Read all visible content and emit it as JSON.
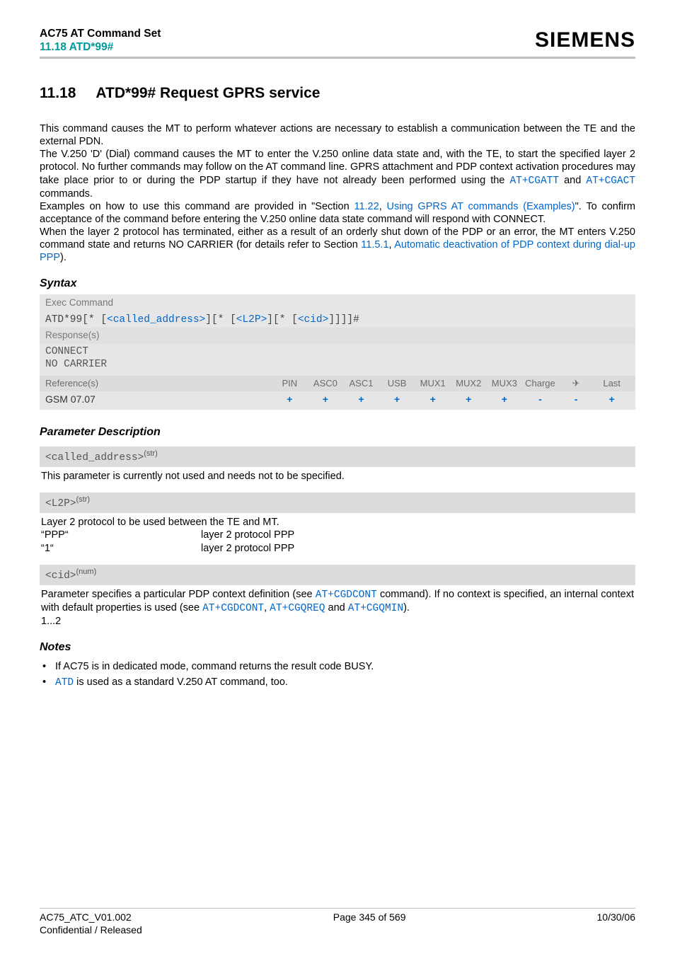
{
  "header": {
    "title_line1": "AC75 AT Command Set",
    "title_line2": "11.18 ATD*99#",
    "brand": "SIEMENS"
  },
  "section": {
    "number": "11.18",
    "title": "ATD*99#   Request GPRS service"
  },
  "intro": {
    "p1a": "This command causes the MT to perform whatever actions are necessary to establish a communication between the TE and the external PDN.",
    "p1b_pre": "The V.250 'D' (Dial) command causes the MT to enter the V.250 online data state and, with the TE, to start the specified layer 2 protocol. No further commands may follow on the AT command line. GPRS attachment and PDP context activation procedures may take place prior to or during the PDP startup if they have not already been performed using the ",
    "at_cgatt": "AT+CGATT",
    "and": " and ",
    "at_cgact": "AT+CGACT",
    "p1b_post": " commands.",
    "p2_pre": "Examples on how to use this command are provided in \"Section ",
    "sec_ref": "11.22",
    "sec_sep": ", ",
    "sec_name": "Using GPRS AT commands (Examples)",
    "p2_post": "\". To confirm acceptance of the command before entering the V.250 online data state command will respond with CONNECT.",
    "p3_pre": "When the layer 2 protocol has terminated, either as a result of an orderly shut down of the PDP or an error, the MT enters V.250 command state and returns NO CARRIER (for details refer to Section ",
    "p3_ref": "11.5.1",
    "p3_sep": ", ",
    "p3_name": "Automatic deactivation of PDP context during dial-up PPP",
    "p3_post": ")."
  },
  "syntax": {
    "heading": "Syntax",
    "exec_label": "Exec Command",
    "cmd_prefix": "ATD*99",
    "cmd_open1": "[* [",
    "called_address": "<called_address>",
    "cmd_mid1": "][* [",
    "l2p": "<L2P>",
    "cmd_mid2": "][* [",
    "cid": "<cid>",
    "cmd_end": "]]]]#",
    "responses_label": "Response(s)",
    "resp1": "CONNECT",
    "resp2": "NO CARRIER",
    "ref_label": "Reference(s)",
    "ref_cols": [
      "PIN",
      "ASC0",
      "ASC1",
      "USB",
      "MUX1",
      "MUX2",
      "MUX3",
      "Charge",
      "✈",
      "Last"
    ],
    "ref_name": "GSM 07.07",
    "ref_vals": [
      "+",
      "+",
      "+",
      "+",
      "+",
      "+",
      "+",
      "-",
      "-",
      "+"
    ]
  },
  "params": {
    "heading": "Parameter Description",
    "called_address_tag": "<called_address>",
    "called_address_sup": "(str)",
    "called_address_desc": "This parameter is currently not used and needs not to be specified.",
    "l2p_tag": "<L2P>",
    "l2p_sup": "(str)",
    "l2p_desc": "Layer 2 protocol to be used between the TE and MT.",
    "l2p_rows": [
      {
        "k": "“PPP“",
        "v": "layer 2 protocol PPP"
      },
      {
        "k": "“1“",
        "v": "layer 2 protocol PPP"
      }
    ],
    "cid_tag": "<cid>",
    "cid_sup": "(num)",
    "cid_desc_pre": "Parameter specifies a particular PDP context definition (see ",
    "cid_link1": "AT+CGDCONT",
    "cid_mid1": " command). If no context is specified, an internal context with default properties is used (see ",
    "cid_link2": "AT+CGDCONT",
    "cid_comma1": ", ",
    "cid_link3": "AT+CGQREQ",
    "cid_and": " and ",
    "cid_link4": "AT+CGQMIN",
    "cid_desc_post": ").",
    "cid_range": "1...2"
  },
  "notes": {
    "heading": "Notes",
    "items": [
      {
        "pre": "If AC75 is in dedicated mode, command returns the result code BUSY.",
        "link": "",
        "post": ""
      },
      {
        "pre": "",
        "link": "ATD",
        "post": " is used as a standard V.250 AT command, too."
      }
    ]
  },
  "footer": {
    "l1": "AC75_ATC_V01.002",
    "l2": "Confidential / Released",
    "center": "Page 345 of 569",
    "right": "10/30/06"
  }
}
